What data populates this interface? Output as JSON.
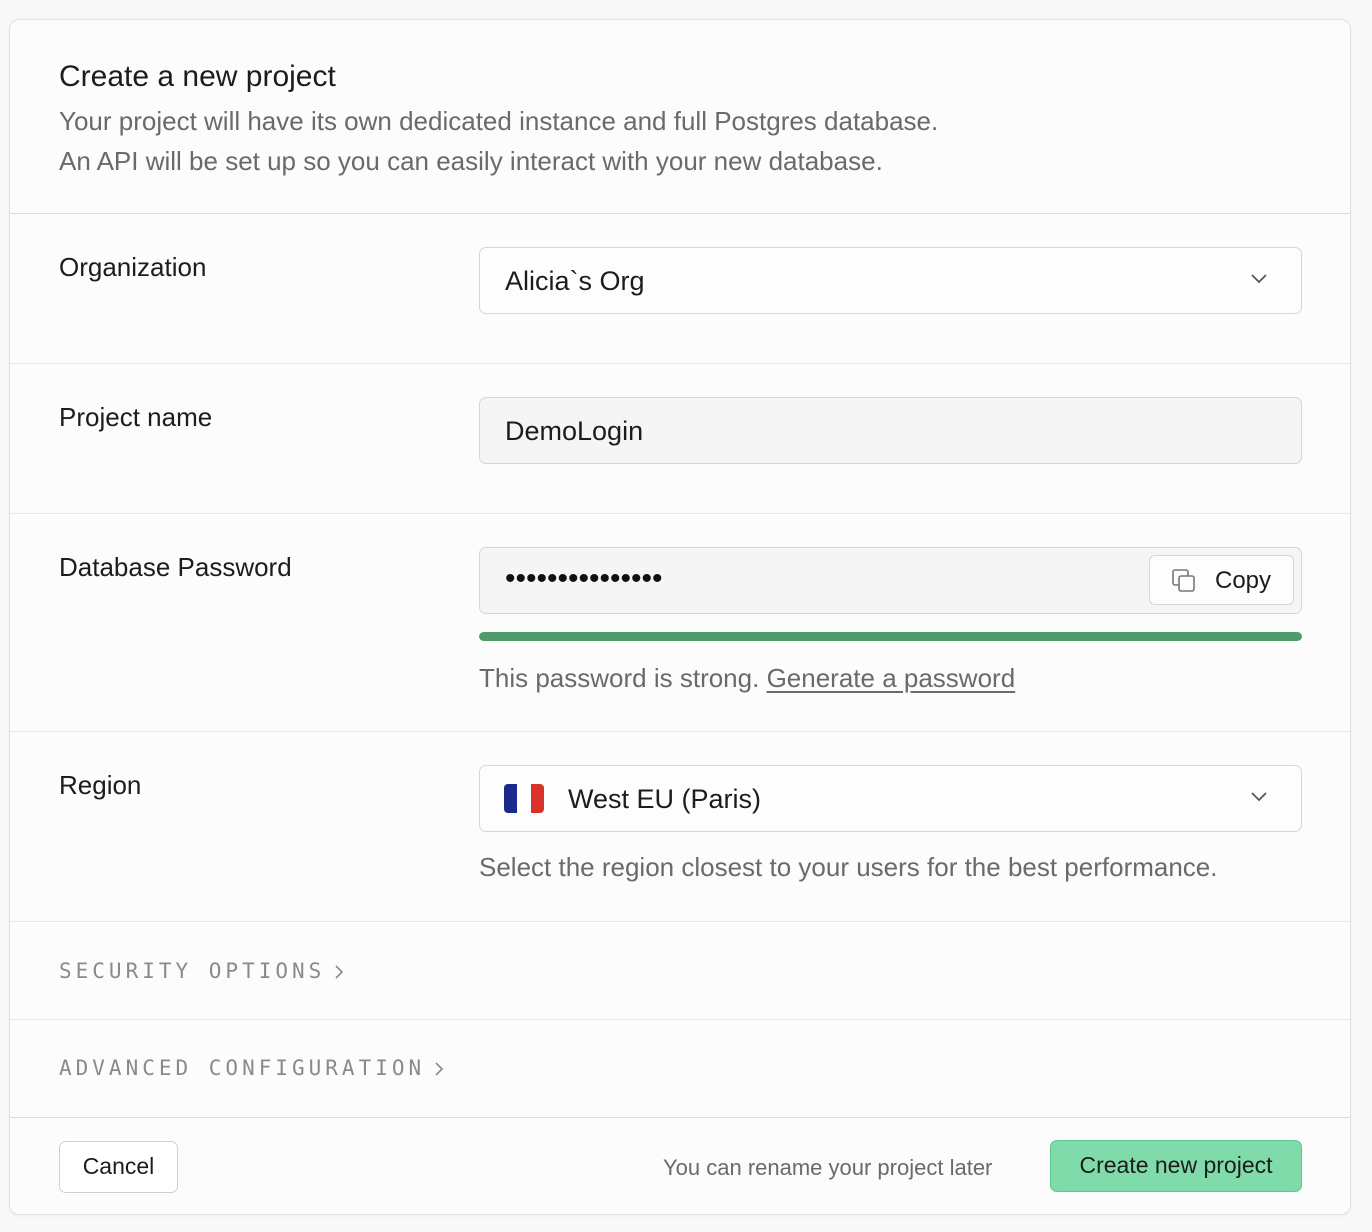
{
  "header": {
    "title": "Create a new project",
    "description_line1": "Your project will have its own dedicated instance and full Postgres database.",
    "description_line2": "An API will be set up so you can easily interact with your new database."
  },
  "organization": {
    "label": "Organization",
    "selected": "Alicia`s Org",
    "icon": "chevron-down-icon"
  },
  "project_name": {
    "label": "Project name",
    "value": "DemoLogin"
  },
  "database_password": {
    "label": "Database Password",
    "masked_value": "•••••••••••••••",
    "copy_label": "Copy",
    "strength_fraction": 1.0,
    "strength_color": "#4f9a6a",
    "hint_text": "This password is strong. ",
    "generate_link": "Generate a password"
  },
  "region": {
    "label": "Region",
    "selected": "West EU (Paris)",
    "flag_colors": [
      "#1a2a8c",
      "#ffffff",
      "#d8322a"
    ],
    "hint": "Select the region closest to your users for the best performance."
  },
  "security_options": {
    "label": "SECURITY OPTIONS"
  },
  "advanced_configuration": {
    "label": "ADVANCED CONFIGURATION"
  },
  "footer": {
    "cancel_label": "Cancel",
    "rename_note": "You can rename your project later",
    "create_label": "Create new project",
    "accent_color": "#7fdcaa"
  }
}
